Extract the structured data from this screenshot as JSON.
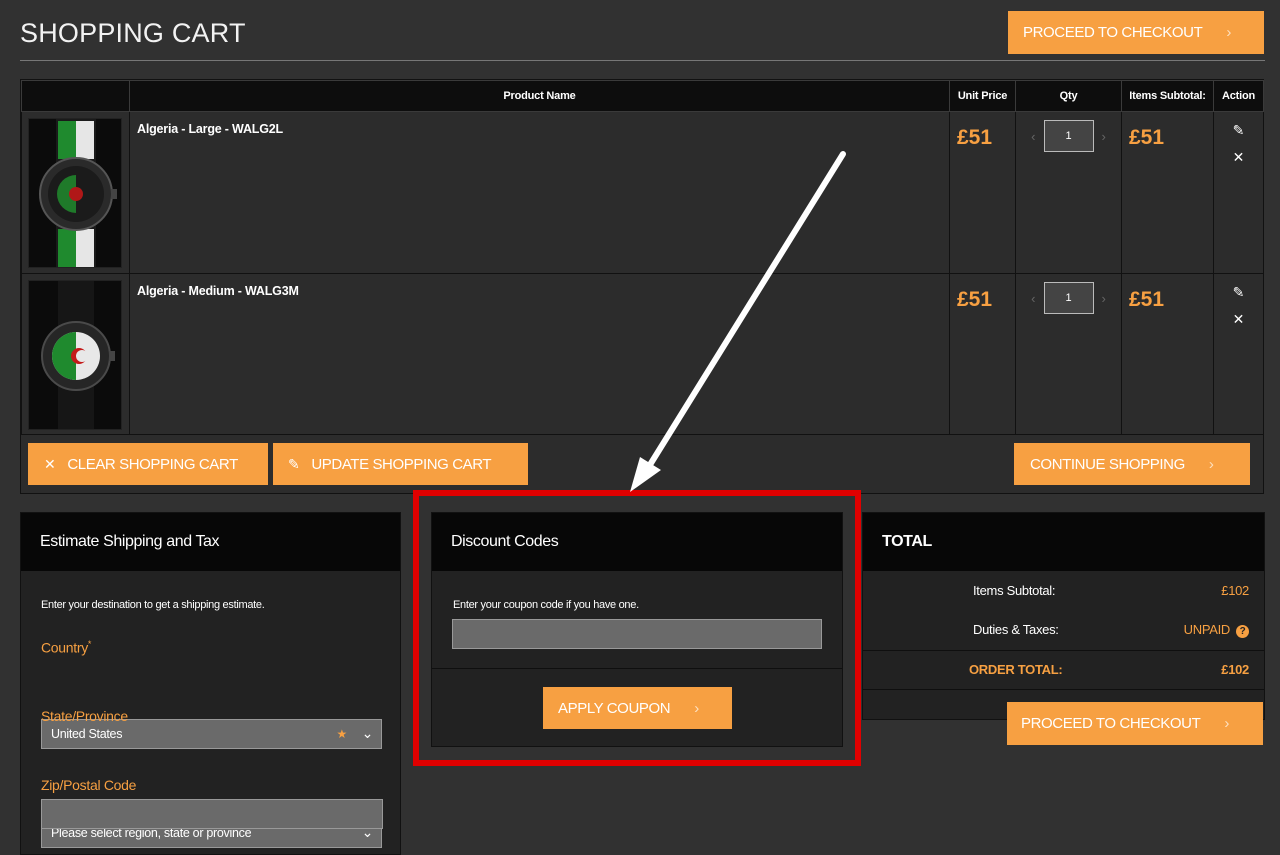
{
  "page_title": "SHOPPING CART",
  "checkout_label": "PROCEED TO CHECKOUT",
  "chevron": "›",
  "table": {
    "headers": [
      "Product Name",
      "Unit Price",
      "Qty",
      "Items Subtotal:",
      "Action"
    ],
    "rows": [
      {
        "name": "Algeria - Large - WALG2L",
        "unit_price": "£51",
        "qty": "1",
        "subtotal": "£51",
        "strap": "green-white"
      },
      {
        "name": "Algeria - Medium - WALG3M",
        "unit_price": "£51",
        "qty": "1",
        "subtotal": "£51",
        "strap": "black"
      }
    ],
    "edit_icon": "✎",
    "remove_icon": "✕",
    "qty_left": "‹",
    "qty_right": "›"
  },
  "cart_buttons": {
    "clear": "CLEAR SHOPPING CART",
    "update": "UPDATE SHOPPING CART",
    "continue": "CONTINUE SHOPPING",
    "clear_icon": "✕",
    "update_icon": "✎"
  },
  "shipping": {
    "title": "Estimate Shipping and Tax",
    "note": "Enter your destination to get a shipping estimate.",
    "country_label": "Country",
    "required_mark": "*",
    "country_value": "United States",
    "star": "★",
    "state_label": "State/Province",
    "state_placeholder": "Please select region, state or province",
    "zip_label": "Zip/Postal Code",
    "chevron_down": "⌄"
  },
  "discount": {
    "title": "Discount Codes",
    "note": "Enter your coupon code if you have one.",
    "apply_label": "APPLY COUPON"
  },
  "totals": {
    "title": "TOTAL",
    "subtotal_label": "Items Subtotal:",
    "subtotal_value": "£102",
    "duties_label": "Duties & Taxes:",
    "duties_value": "UNPAID",
    "duties_help": "?",
    "order_total_label": "ORDER TOTAL:",
    "order_total_value": "£102"
  },
  "colors": {
    "accent": "#f7a042",
    "highlight": "#e00000",
    "background": "#313131"
  }
}
